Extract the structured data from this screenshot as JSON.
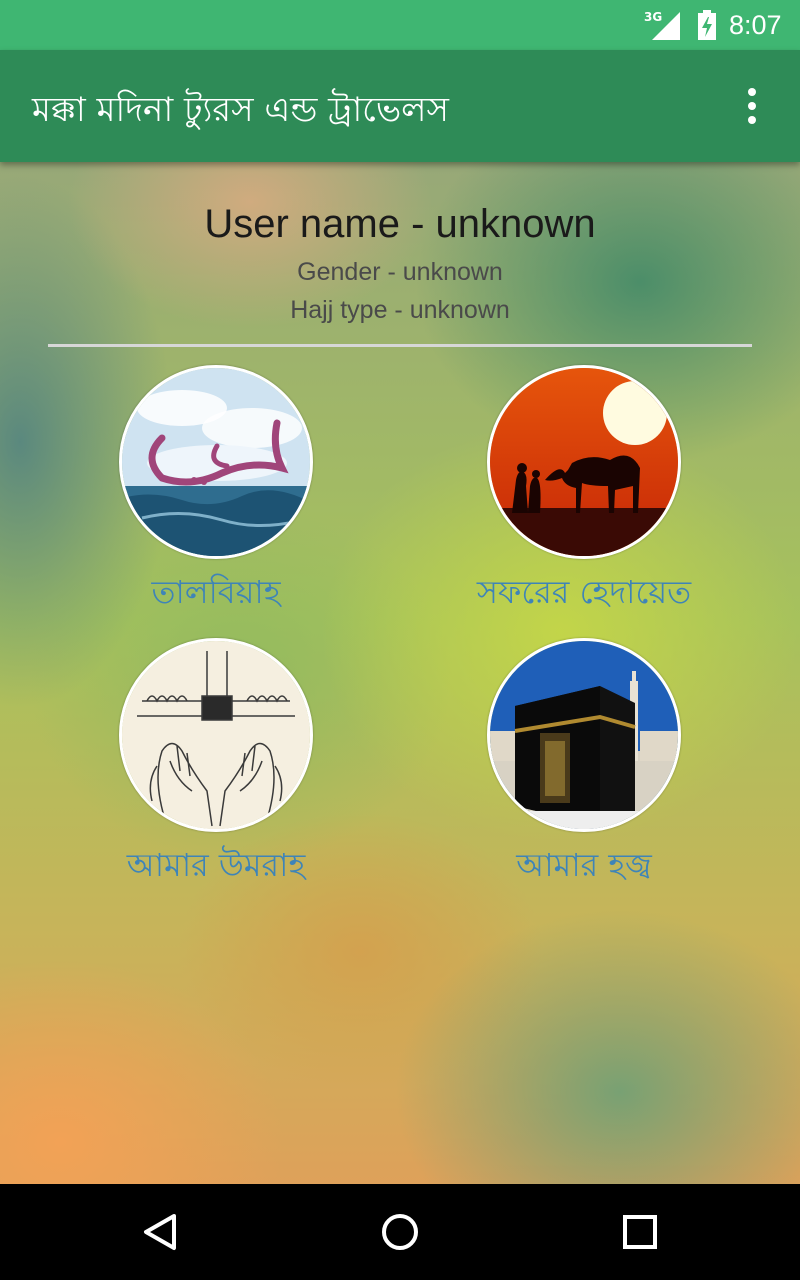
{
  "status_bar": {
    "network": "3G",
    "time": "8:07"
  },
  "app_bar": {
    "title": "মক্কা মদিনা ট্যুরস এন্ড ট্রাভেলস"
  },
  "profile": {
    "user_name": "User name - unknown",
    "gender": "Gender - unknown",
    "hajj_type": "Hajj type - unknown"
  },
  "tiles": [
    {
      "label": "তালবিয়াহ",
      "icon": "labbaik-calligraphy-sea-image"
    },
    {
      "label": "সফরের হেদায়েত",
      "icon": "camel-sunset-image"
    },
    {
      "label": "আমার উমরাহ",
      "icon": "praying-hands-kaaba-sketch-image"
    },
    {
      "label": "আমার হজ্ব",
      "icon": "kaaba-photo-image"
    }
  ],
  "nav": {
    "icons": [
      "back-icon",
      "home-icon",
      "recents-icon"
    ]
  },
  "colors": {
    "status_bar": "#3fb672",
    "app_bar": "#2e8b57",
    "tile_label": "#3e84b8"
  }
}
